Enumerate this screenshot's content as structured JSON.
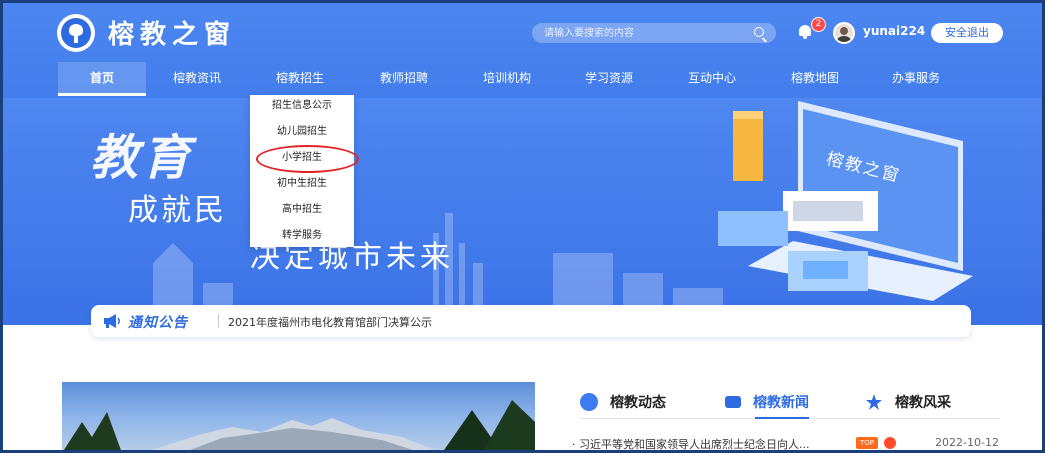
{
  "header": {
    "site_title": "榕教之窗",
    "search_placeholder": "请输入要搜索的内容",
    "notification_count": "2",
    "username": "yunai224",
    "logout_label": "安全退出"
  },
  "nav": {
    "items": [
      {
        "label": "首页"
      },
      {
        "label": "榕教资讯"
      },
      {
        "label": "榕教招生"
      },
      {
        "label": "教师招聘"
      },
      {
        "label": "培训机构"
      },
      {
        "label": "学习资源"
      },
      {
        "label": "互动中心"
      },
      {
        "label": "榕教地图"
      },
      {
        "label": "办事服务"
      }
    ]
  },
  "dropdown": {
    "items": [
      {
        "label": "招生信息公示"
      },
      {
        "label": "幼儿园招生"
      },
      {
        "label": "小学招生"
      },
      {
        "label": "初中生招生"
      },
      {
        "label": "高中招生"
      },
      {
        "label": "转学服务"
      }
    ]
  },
  "hero": {
    "big": "教育",
    "line2": "成就民　　福",
    "line3": "决定城市未来",
    "screen_text": "榕教之窗"
  },
  "notice": {
    "label": "通知公告",
    "text": "2021年度福州市电化教育馆部门决算公示"
  },
  "news": {
    "tabs": [
      {
        "label": "榕教动态",
        "icon": "new-icon"
      },
      {
        "label": "榕教新闻",
        "icon": "news-icon"
      },
      {
        "label": "榕教风采",
        "icon": "star-icon"
      }
    ],
    "first_item": {
      "title": "· 习近平等党和国家领导人出席烈士纪念日向人...",
      "tag": "TOP",
      "date": "2022-10-12"
    }
  },
  "colors": {
    "brand_blue": "#3e79ea",
    "accent_blue": "#2f6be0",
    "annotation_red": "#e22424",
    "top_tag": "#ff6a1c"
  }
}
